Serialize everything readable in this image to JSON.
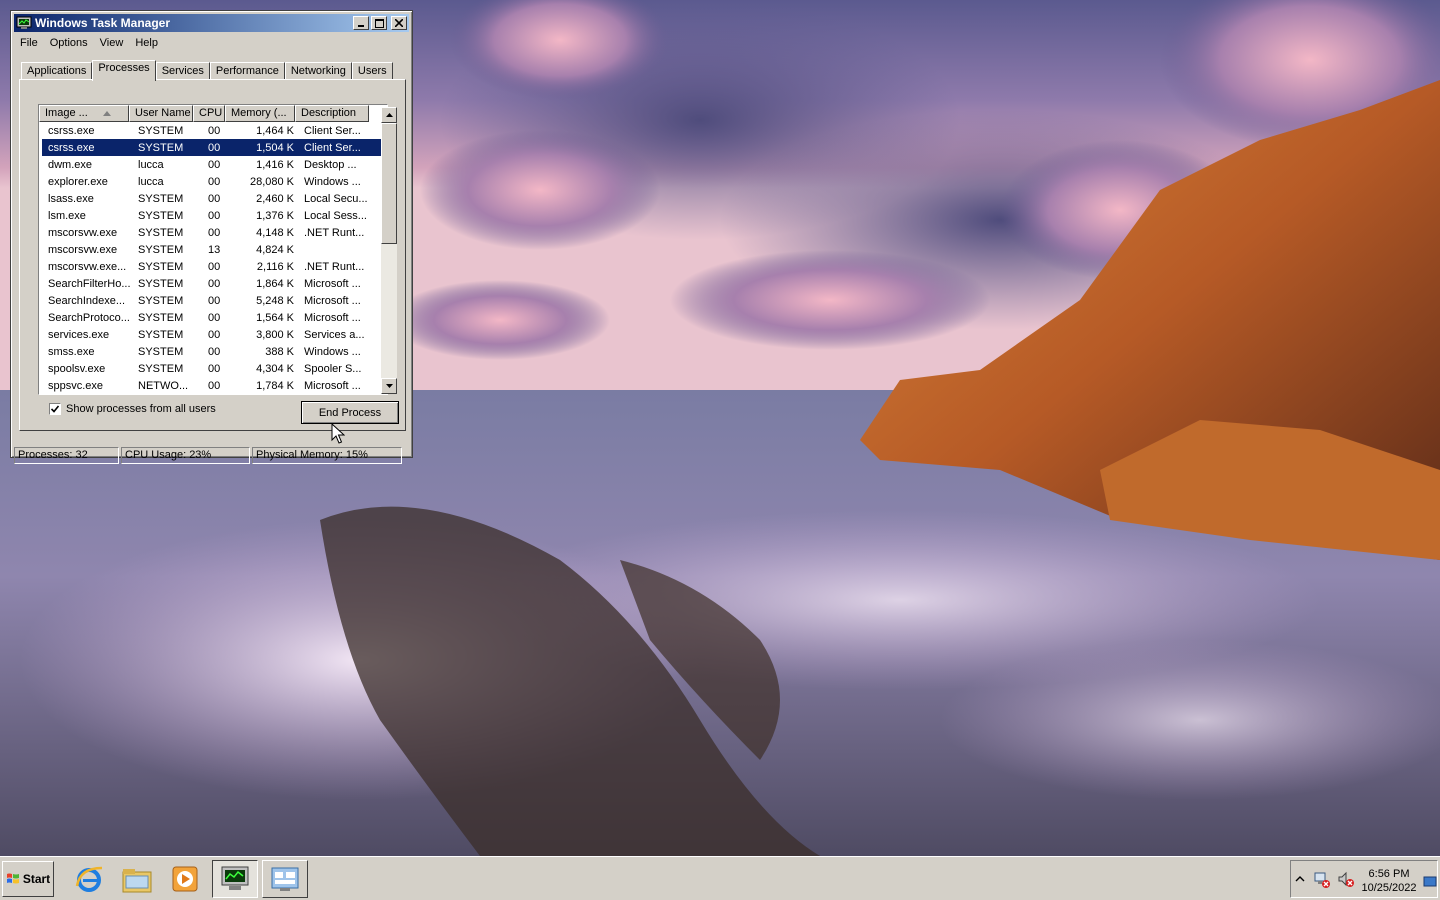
{
  "window": {
    "title": "Windows Task Manager",
    "menu": [
      "File",
      "Options",
      "View",
      "Help"
    ],
    "tabs": [
      "Applications",
      "Processes",
      "Services",
      "Performance",
      "Networking",
      "Users"
    ],
    "active_tab": "Processes"
  },
  "processes": {
    "columns": [
      "Image ...",
      "User Name",
      "CPU",
      "Memory (...",
      "Description"
    ],
    "sort_column": "Image ...",
    "selected_index": 1,
    "rows": [
      {
        "image": "csrss.exe",
        "user": "SYSTEM",
        "cpu": "00",
        "mem": "1,464 K",
        "desc": "Client Ser..."
      },
      {
        "image": "csrss.exe",
        "user": "SYSTEM",
        "cpu": "00",
        "mem": "1,504 K",
        "desc": "Client Ser..."
      },
      {
        "image": "dwm.exe",
        "user": "lucca",
        "cpu": "00",
        "mem": "1,416 K",
        "desc": "Desktop ..."
      },
      {
        "image": "explorer.exe",
        "user": "lucca",
        "cpu": "00",
        "mem": "28,080 K",
        "desc": "Windows ..."
      },
      {
        "image": "lsass.exe",
        "user": "SYSTEM",
        "cpu": "00",
        "mem": "2,460 K",
        "desc": "Local Secu..."
      },
      {
        "image": "lsm.exe",
        "user": "SYSTEM",
        "cpu": "00",
        "mem": "1,376 K",
        "desc": "Local Sess..."
      },
      {
        "image": "mscorsvw.exe",
        "user": "SYSTEM",
        "cpu": "00",
        "mem": "4,148 K",
        "desc": ".NET Runt..."
      },
      {
        "image": "mscorsvw.exe",
        "user": "SYSTEM",
        "cpu": "13",
        "mem": "4,824 K",
        "desc": ""
      },
      {
        "image": "mscorsvw.exe...",
        "user": "SYSTEM",
        "cpu": "00",
        "mem": "2,116 K",
        "desc": ".NET Runt..."
      },
      {
        "image": "SearchFilterHo...",
        "user": "SYSTEM",
        "cpu": "00",
        "mem": "1,864 K",
        "desc": "Microsoft ..."
      },
      {
        "image": "SearchIndexe...",
        "user": "SYSTEM",
        "cpu": "00",
        "mem": "5,248 K",
        "desc": "Microsoft ..."
      },
      {
        "image": "SearchProtoco...",
        "user": "SYSTEM",
        "cpu": "00",
        "mem": "1,564 K",
        "desc": "Microsoft ..."
      },
      {
        "image": "services.exe",
        "user": "SYSTEM",
        "cpu": "00",
        "mem": "3,800 K",
        "desc": "Services a..."
      },
      {
        "image": "smss.exe",
        "user": "SYSTEM",
        "cpu": "00",
        "mem": "388 K",
        "desc": "Windows ..."
      },
      {
        "image": "spoolsv.exe",
        "user": "SYSTEM",
        "cpu": "00",
        "mem": "4,304 K",
        "desc": "Spooler S..."
      },
      {
        "image": "sppsvc.exe",
        "user": "NETWO...",
        "cpu": "00",
        "mem": "1,784 K",
        "desc": "Microsoft ..."
      }
    ],
    "show_all_label": "Show processes from all users",
    "show_all_checked": true,
    "end_process_label": "End Process"
  },
  "status": {
    "processes": "Processes: 32",
    "cpu": "CPU Usage: 23%",
    "memory": "Physical Memory: 15%"
  },
  "taskbar": {
    "start_label": "Start",
    "icons": [
      "internet-explorer-icon",
      "file-explorer-icon",
      "media-player-icon",
      "task-manager-icon",
      "control-panel-icon"
    ],
    "active_icon": "task-manager-icon",
    "tray_icons": [
      "show-hidden-icons-chevron",
      "network-disconnected-icon",
      "volume-muted-icon"
    ],
    "clock_time": "6:56 PM",
    "clock_date": "10/25/2022"
  },
  "colors": {
    "selection": "#0a246a",
    "title_gradient_start": "#0a246a",
    "title_gradient_end": "#a6caf0",
    "face": "#d4d0c8"
  }
}
